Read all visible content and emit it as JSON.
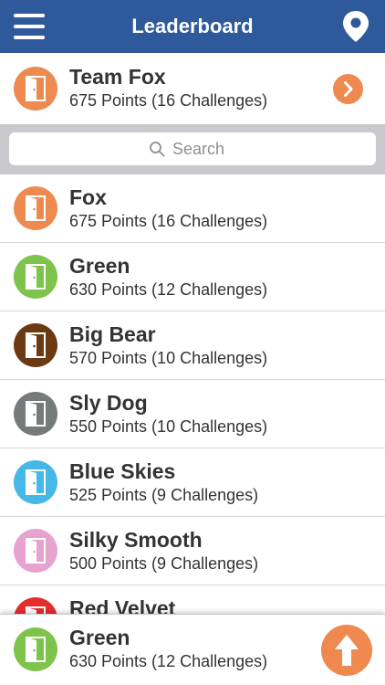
{
  "header": {
    "title": "Leaderboard",
    "menu_icon": "hamburger-menu-icon",
    "location_icon": "map-pin-icon"
  },
  "team": {
    "name": "Team Fox",
    "points": "675 Points (16 Challenges)",
    "color": "#ee8a4f"
  },
  "search": {
    "placeholder": "Search"
  },
  "entries": [
    {
      "name": "Fox",
      "points": "675 Points (16 Challenges)",
      "color": "#ee8a4f"
    },
    {
      "name": "Green",
      "points": "630 Points (12 Challenges)",
      "color": "#7ec34a"
    },
    {
      "name": "Big Bear",
      "points": "570 Points (10 Challenges)",
      "color": "#6b3a12"
    },
    {
      "name": "Sly Dog",
      "points": "550 Points (10 Challenges)",
      "color": "#777a7a"
    },
    {
      "name": "Blue Skies",
      "points": "525 Points (9 Challenges)",
      "color": "#45b8e8"
    },
    {
      "name": "Silky Smooth",
      "points": "500 Points (9 Challenges)",
      "color": "#e7a3cf"
    },
    {
      "name": "Red Velvet",
      "points": "",
      "color": "#e42e2e"
    }
  ],
  "current": {
    "name": "Green",
    "points": "630 Points (12 Challenges)",
    "color": "#7ec34a"
  },
  "colors": {
    "header": "#2e5a9b",
    "accent": "#ee8a4f",
    "search_strip": "#c9c9ce"
  }
}
